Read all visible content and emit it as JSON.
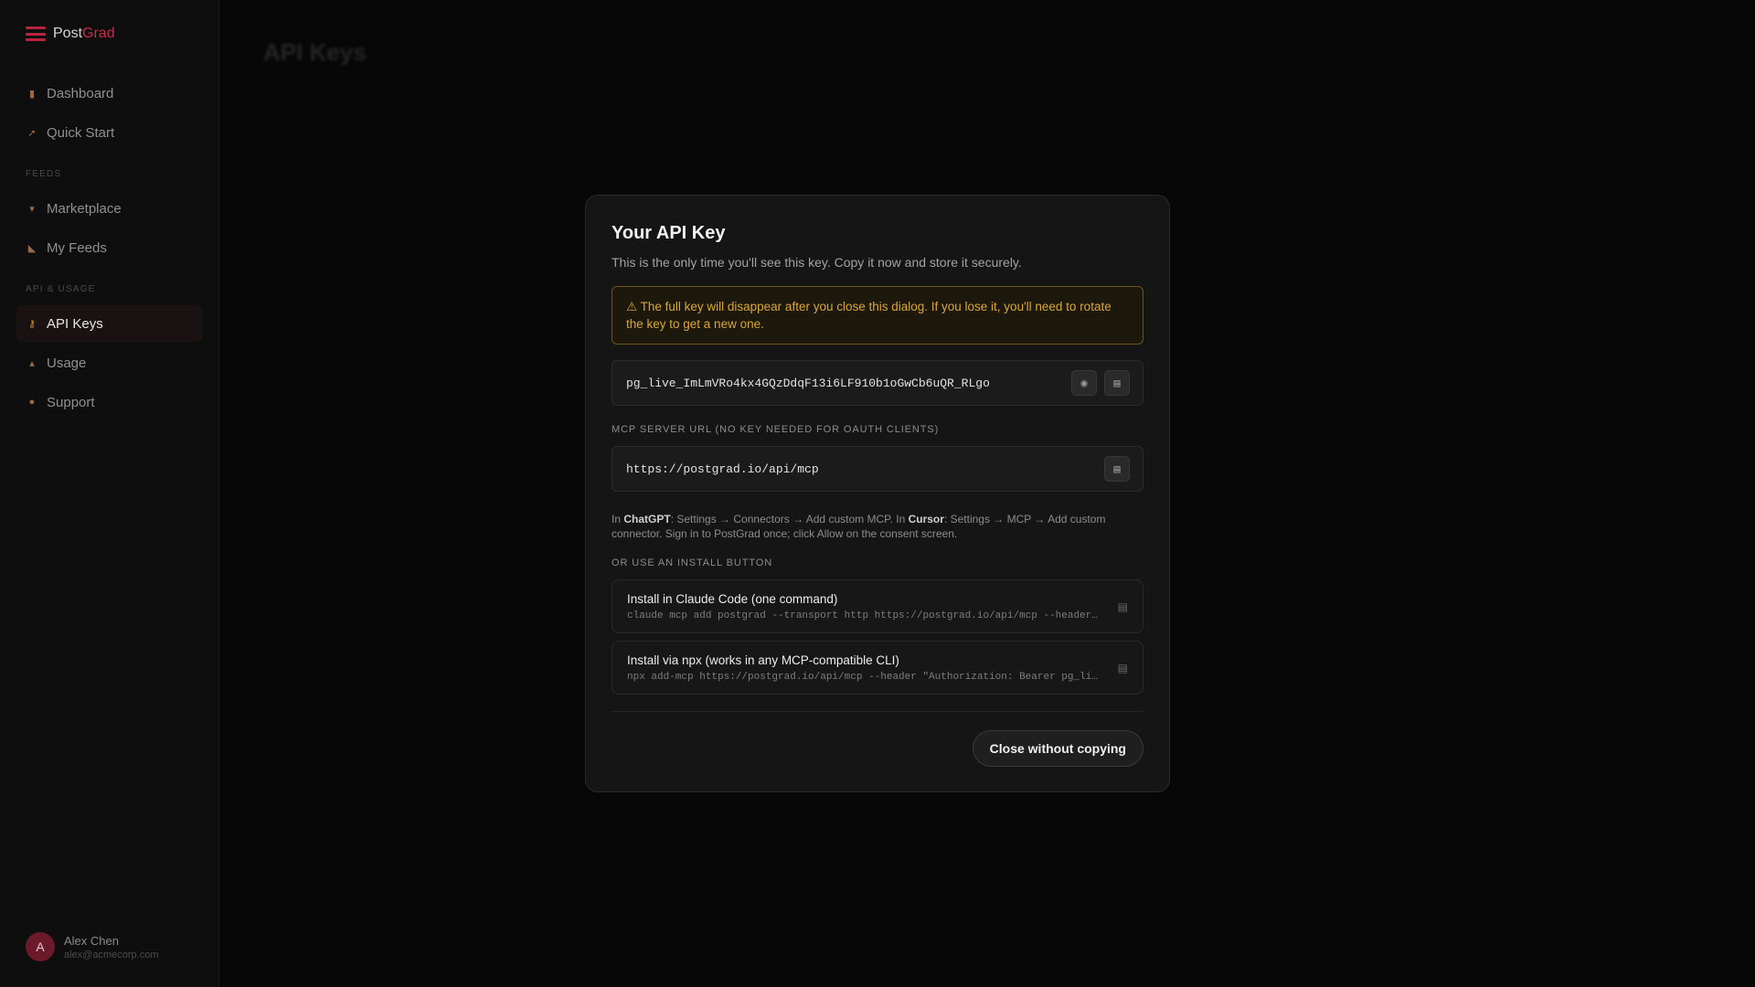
{
  "app": {
    "brand_prefix": "Post",
    "brand_accent": "Grad",
    "accent_color": "#c62b4a"
  },
  "sidebar": {
    "items_top": [
      {
        "label": "Dashboard",
        "icon": "chart-icon"
      },
      {
        "label": "Quick Start",
        "icon": "rocket-icon"
      }
    ],
    "section_feeds": "FEEDS",
    "items_feeds": [
      {
        "label": "Marketplace",
        "icon": "cart-icon"
      },
      {
        "label": "My Feeds",
        "icon": "satellite-icon"
      }
    ],
    "section_api": "API & USAGE",
    "items_api": [
      {
        "label": "API Keys",
        "icon": "key-icon",
        "active": true
      },
      {
        "label": "Usage",
        "icon": "trend-icon"
      },
      {
        "label": "Support",
        "icon": "chat-icon"
      }
    ]
  },
  "user": {
    "initial": "A",
    "name": "Alex Chen",
    "email": "alex@acmecorp.com"
  },
  "page": {
    "title": "API Keys"
  },
  "dialog": {
    "title": "Your API Key",
    "subtitle": "This is the only time you'll see this key. Copy it now and store it securely.",
    "warning": "⚠ The full key will disappear after you close this dialog. If you lose it, you'll need to rotate the key to get a new one.",
    "api_key": "pg_live_ImLmVRo4kx4GQzDdqF13i6LF910b1oGwCb6uQR_RLgo",
    "mcp_label": "MCP SERVER URL (NO KEY NEEDED FOR OAUTH CLIENTS)",
    "mcp_url": "https://postgrad.io/api/mcp",
    "help": {
      "p1": "In ",
      "chatgpt": "ChatGPT",
      "p2": ": Settings → Connectors → Add custom MCP. In ",
      "cursor": "Cursor",
      "p3": ": Settings → MCP → Add custom connector. Sign in to PostGrad once; click Allow on the consent screen."
    },
    "install_label": "OR USE AN INSTALL BUTTON",
    "installs": [
      {
        "title": "Install in Claude Code (one command)",
        "command": "claude mcp add postgrad --transport http https://postgrad.io/api/mcp --header…"
      },
      {
        "title": "Install via npx (works in any MCP-compatible CLI)",
        "command": "npx add-mcp https://postgrad.io/api/mcp --header \"Authorization: Bearer pg_li…"
      }
    ],
    "close_label": "Close without copying"
  }
}
